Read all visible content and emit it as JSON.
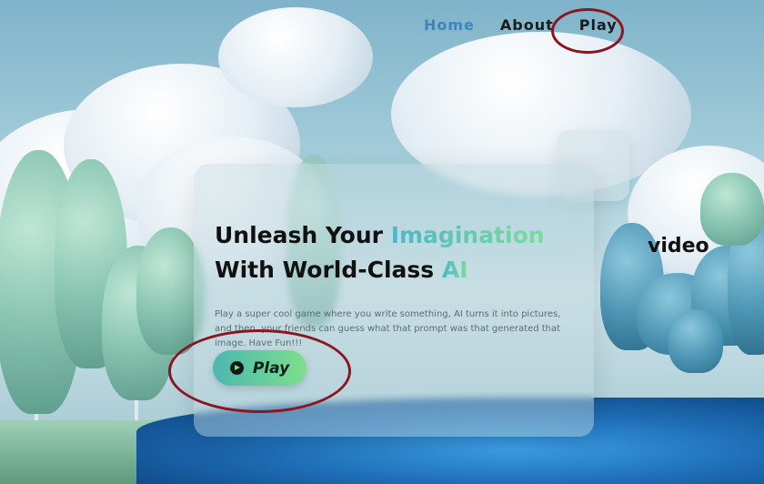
{
  "nav": {
    "items": [
      {
        "label": "Home"
      },
      {
        "label": "About"
      },
      {
        "label": "Play"
      }
    ]
  },
  "hero": {
    "headline_line1_part1": "Unleash Your ",
    "headline_line1_highlight": "Imagination",
    "headline_line2_part1": "With World-Class ",
    "headline_line2_highlight": "AI",
    "description": "Play a super cool game where you write something, AI turns it into pictures, and then, your friends can guess what that prompt was that generated that image. Have Fun!!!",
    "play_button_label": "Play"
  },
  "side": {
    "video_label": "video"
  },
  "colors": {
    "accent_start": "#4db6c6",
    "accent_end": "#7ddc9e",
    "annotation_circle": "#8a1620",
    "nav_active": "#3b86bf"
  },
  "icons": {
    "play_icon": "play-circle-icon"
  }
}
